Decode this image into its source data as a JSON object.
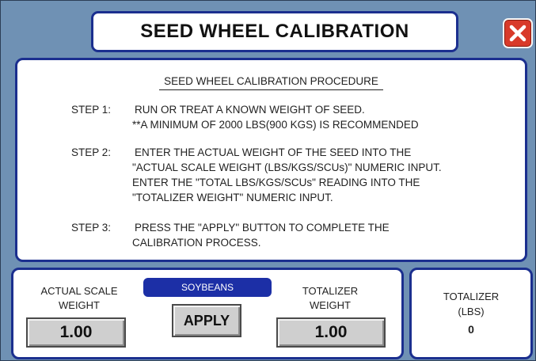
{
  "header": {
    "title": "SEED WHEEL CALIBRATION"
  },
  "procedure": {
    "heading": "SEED WHEEL CALIBRATION PROCEDURE",
    "steps": [
      {
        "label": "STEP 1:",
        "lines": [
          "RUN OR TREAT A KNOWN WEIGHT OF SEED.",
          "**A MINIMUM OF 2000 LBS(900 KGS) IS RECOMMENDED"
        ]
      },
      {
        "label": "STEP 2:",
        "lines": [
          "ENTER THE ACTUAL WEIGHT OF THE SEED INTO THE",
          "\"ACTUAL SCALE WEIGHT (LBS/KGS/SCUs)\" NUMERIC INPUT.",
          "ENTER THE \"TOTAL LBS/KGS/SCUs\" READING INTO THE",
          "\"TOTALIZER WEIGHT\" NUMERIC INPUT."
        ]
      },
      {
        "label": "STEP 3:",
        "lines": [
          "PRESS THE \"APPLY\" BUTTON TO COMPLETE THE",
          "CALIBRATION PROCESS."
        ]
      }
    ]
  },
  "controls": {
    "actual_scale_label_line1": "ACTUAL SCALE",
    "actual_scale_label_line2": "WEIGHT",
    "actual_scale_value": "1.00",
    "seed_type_button": "SOYBEANS",
    "apply_button": "APPLY",
    "totalizer_label_line1": "TOTALIZER",
    "totalizer_label_line2": "WEIGHT",
    "totalizer_value": "1.00"
  },
  "totalizer_panel": {
    "label_line1": "TOTALIZER",
    "label_line2": "(LBS)",
    "value": "0"
  },
  "colors": {
    "background": "#6f91b4",
    "border_blue": "#1b2f8f",
    "seed_button": "#1c2fa6",
    "close_red": "#d83a2a"
  },
  "icons": {
    "close": "close-icon"
  }
}
